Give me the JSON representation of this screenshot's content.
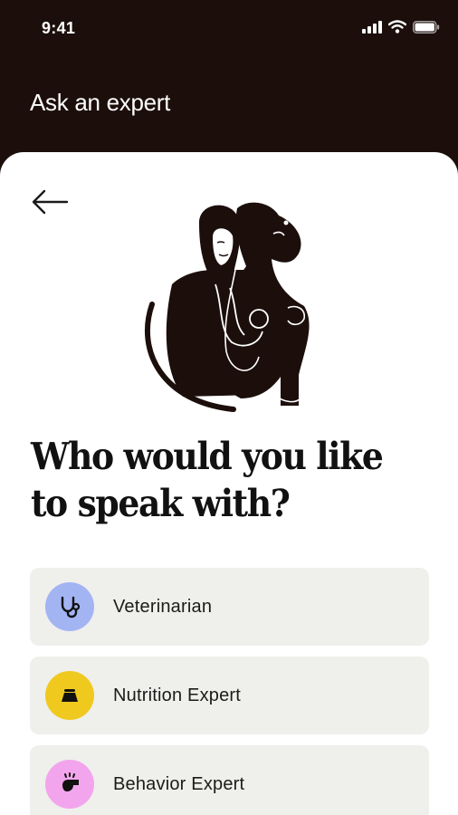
{
  "status_bar": {
    "time": "9:41"
  },
  "header": {
    "title": "Ask an expert"
  },
  "question": "Who would you like to speak with?",
  "options": [
    {
      "label": "Veterinarian",
      "icon": "stethoscope-icon",
      "color": "#a3b4f3"
    },
    {
      "label": "Nutrition Expert",
      "icon": "food-bowl-icon",
      "color": "#f0c91f"
    },
    {
      "label": "Behavior Expert",
      "icon": "whistle-icon",
      "color": "#f2a5ec"
    }
  ],
  "colors": {
    "background": "#1c0f0b",
    "sheet": "#ffffff",
    "option_bg": "#efefec"
  }
}
